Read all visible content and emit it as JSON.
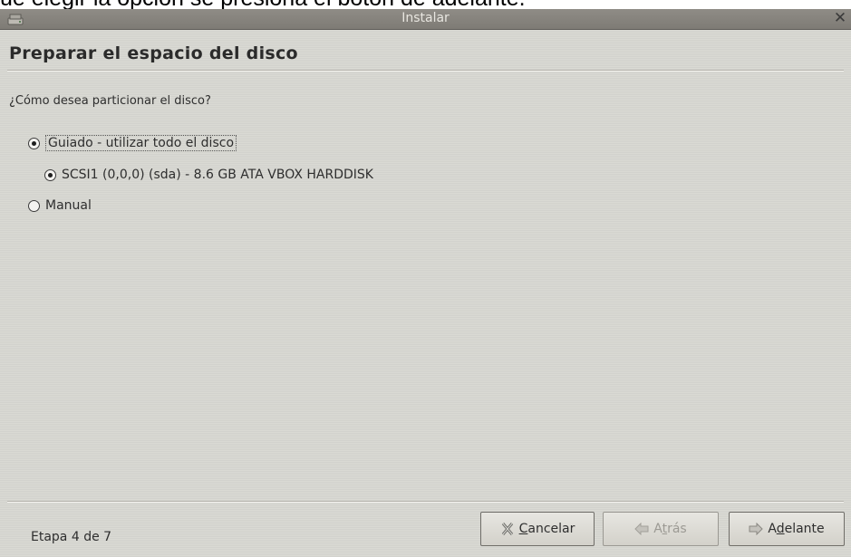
{
  "caption": "ue elegir la opcion se presiona el boton de adelante.",
  "window": {
    "title": "Instalar",
    "close_glyph": "✕",
    "app_icon": "disk-drive-icon"
  },
  "page": {
    "header": "Preparar el espacio del disco",
    "question": "¿Cómo desea particionar el disco?"
  },
  "options": {
    "guided": {
      "label": "Guiado - utilizar todo el disco",
      "selected": true
    },
    "disk": {
      "label": "SCSI1 (0,0,0) (sda) - 8.6 GB ATA VBOX HARDDISK",
      "selected": true
    },
    "manual": {
      "label": "Manual",
      "selected": false
    }
  },
  "footer": {
    "step": "Etapa 4 de 7",
    "cancel": {
      "pre": "",
      "mnemonic": "C",
      "post": "ancelar",
      "icon": "cancel-x-icon"
    },
    "back": {
      "pre": "A",
      "mnemonic": "t",
      "post": "rás",
      "icon": "arrow-left-icon",
      "enabled": false
    },
    "forward": {
      "pre": "A",
      "mnemonic": "d",
      "post": "elante",
      "icon": "arrow-right-icon",
      "enabled": true
    }
  },
  "colors": {
    "window_bg": "#dadad4",
    "titlebar": "#8a8780",
    "text": "#2e2e2e"
  }
}
